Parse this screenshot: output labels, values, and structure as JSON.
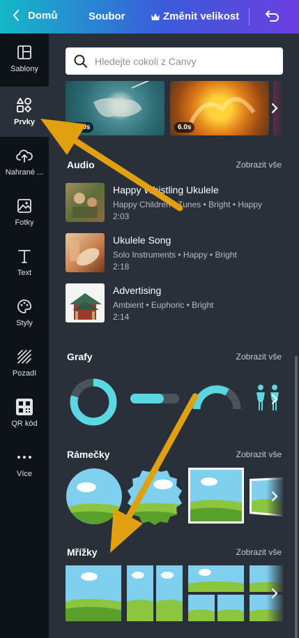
{
  "topbar": {
    "home": "Domů",
    "file": "Soubor",
    "resize": "Změnit velikost"
  },
  "sidebar": {
    "items": [
      {
        "label": "Šablony",
        "icon": "templates-icon"
      },
      {
        "label": "Prvky",
        "icon": "elements-icon"
      },
      {
        "label": "Nahrané ...",
        "icon": "upload-icon"
      },
      {
        "label": "Fotky",
        "icon": "photos-icon"
      },
      {
        "label": "Text",
        "icon": "text-icon"
      },
      {
        "label": "Styly",
        "icon": "palette-icon"
      },
      {
        "label": "Pozadí",
        "icon": "background-icon"
      },
      {
        "label": "QR kód",
        "icon": "qr-code-icon"
      },
      {
        "label": "Více",
        "icon": "more-icon"
      }
    ],
    "active_index": 1
  },
  "search": {
    "placeholder": "Hledejte cokoli z Canvy"
  },
  "videos": [
    {
      "duration": "11.0s"
    },
    {
      "duration": "6.0s"
    }
  ],
  "see_all": "Zobrazit vše",
  "audio": {
    "title": "Audio",
    "tracks": [
      {
        "title": "Happy Whistling Ukulele",
        "meta": "Happy Children • Tunes • Bright • Happy",
        "duration": "2:03"
      },
      {
        "title": "Ukulele Song",
        "meta": "Solo Instruments • Happy • Bright",
        "duration": "2:18"
      },
      {
        "title": "Advertising",
        "meta": "Ambient • Euphoric • Bright",
        "duration": "2:14"
      }
    ]
  },
  "charts": {
    "title": "Grafy"
  },
  "frames": {
    "title": "Rámečky"
  },
  "grids": {
    "title": "Mřížky"
  },
  "colors": {
    "accent_teal": "#5ad7e0",
    "annotation_arrow": "#e0a00f",
    "panel_bg": "#293039",
    "sidebar_bg": "#0e1318"
  }
}
